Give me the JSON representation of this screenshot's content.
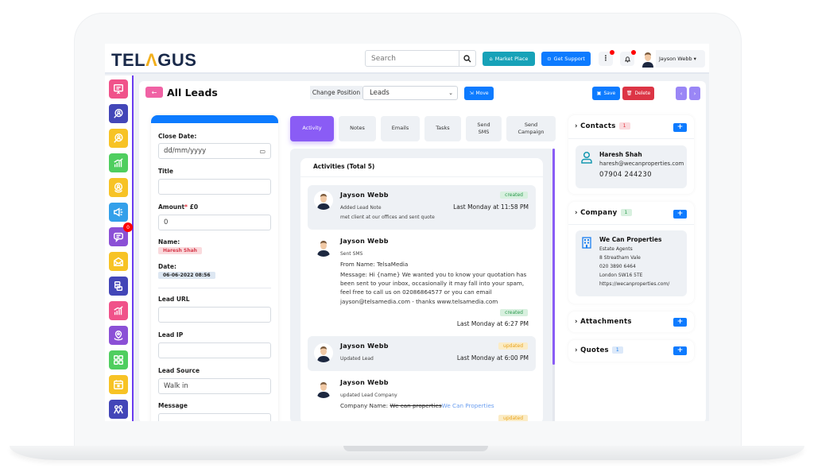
{
  "app": {
    "logo_left": "TEL",
    "logo_accent": "Λ",
    "logo_right": "GUS"
  },
  "topbar": {
    "search_placeholder": "Search",
    "market_place": "Market Place",
    "get_support": "Get Support",
    "user_name": "Jayson Webb ▾"
  },
  "colors": {
    "primary": "#0d7bff",
    "accent_purple": "#8a5cf5",
    "teal": "#17a2b8",
    "danger": "#dc3545",
    "rail": "#6a3cf0"
  },
  "sidebar": {
    "items": [
      {
        "icon": "presentation-icon",
        "color": "#f0528a"
      },
      {
        "icon": "user-search-icon",
        "color": "#4346b8"
      },
      {
        "icon": "user-search-icon",
        "color": "#f7c325"
      },
      {
        "icon": "bar-chart-icon",
        "color": "#4fce5f"
      },
      {
        "icon": "user-badge-icon",
        "color": "#f7c325"
      },
      {
        "icon": "megaphone-icon",
        "color": "#33a0ea"
      },
      {
        "icon": "chat-icon",
        "color": "#8b50d6",
        "badge": "0"
      },
      {
        "icon": "mail-open-icon",
        "color": "#f7c325"
      },
      {
        "icon": "database-icon",
        "color": "#4346b8"
      },
      {
        "icon": "bar-chart-icon",
        "color": "#f0528a"
      },
      {
        "icon": "location-icon",
        "color": "#8b50d6"
      },
      {
        "icon": "grid-icon",
        "color": "#4fce5f"
      },
      {
        "icon": "calendar-icon",
        "color": "#f7c325"
      },
      {
        "icon": "users-icon",
        "color": "#4346b8"
      }
    ]
  },
  "header": {
    "back": "←",
    "title": "All Leads",
    "change_position": "Change Position",
    "position_value": "Leads",
    "move": "Move",
    "save": "Save",
    "delete": "Delete",
    "prev": "‹",
    "next": "›"
  },
  "form": {
    "close_date_label": "Close Date:",
    "close_date_placeholder": "dd/mm/yyyy",
    "title_label": "Title",
    "title_value": "",
    "amount_label": "Amount",
    "amount_req": "*",
    "amount_currency": "£0",
    "amount_value": "0",
    "name_label": "Name:",
    "name_value": "Haresh Shah",
    "date_label": "Date:",
    "date_value": "06-06-2022 08:56",
    "lead_url_label": "Lead URL",
    "lead_url_value": "",
    "lead_ip_label": "Lead IP",
    "lead_ip_value": "",
    "lead_source_label": "Lead Source",
    "lead_source_value": "Walk in",
    "message_label": "Message"
  },
  "tabs": [
    {
      "label": "Activity",
      "active": true
    },
    {
      "label": "Notes"
    },
    {
      "label": "Emails"
    },
    {
      "label": "Tasks"
    },
    {
      "label": "Send SMS"
    },
    {
      "label": "Send Campaign"
    }
  ],
  "activities": {
    "heading": "Activities (Total 5)",
    "items": [
      {
        "name": "Jayson Webb",
        "action": "Added Lead Note",
        "text": "met client at our offices and sent quote",
        "status": "created",
        "time": "Last Monday at 11:58 PM"
      },
      {
        "name": "Jayson Webb",
        "action": "Sent SMS",
        "from": "From Name: TelsaMedia",
        "text": "Message: Hi {name} We wanted you to know your quotation has been sent to your inbox, occasionally it may fall into your spam, feel free to call us on 02086864577 or you can email jayson@telsamedia.com - thanks www.telsamedia.com",
        "status": "created",
        "time": "Last Monday at 6:27 PM"
      },
      {
        "name": "Jayson Webb",
        "action": "Updated Lead",
        "status": "updated",
        "time": "Last Monday at 6:00 PM"
      },
      {
        "name": "Jayson Webb",
        "action": "updated Lead Company",
        "field": "Company Name: ",
        "old": "We can properties",
        "new": "We Can Properties",
        "status": "updated"
      }
    ]
  },
  "right": {
    "contacts": {
      "title": "Contacts",
      "count": "1",
      "name": "Haresh Shah",
      "email": "haresh@wecanproperties.com",
      "phone": "07904 244230"
    },
    "company": {
      "title": "Company",
      "count": "1",
      "name": "We Can Properties",
      "type": "Estate Agents",
      "addr1": "8 Streatham Vale",
      "phone": "020 3890 6464",
      "addr2": "London SW16 5TE",
      "url": "https://wecanproperties.com/"
    },
    "attachments": {
      "title": "Attachments"
    },
    "quotes": {
      "title": "Quotes",
      "count": "1"
    },
    "plus": "+"
  }
}
